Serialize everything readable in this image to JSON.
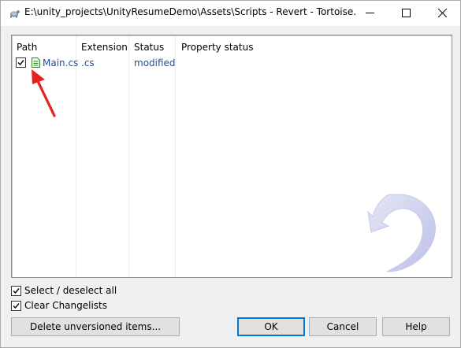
{
  "window": {
    "title": "E:\\unity_projects\\UnityResumeDemo\\Assets\\Scripts - Revert - Tortoise..."
  },
  "icons": {
    "app": "tortoisesvn-turtle-icon",
    "minimize": "minimize-icon",
    "maximize": "maximize-icon",
    "close": "close-icon",
    "file": "text-file-icon",
    "logo": "tortoisesvn-revert-logo",
    "annotation": "red-arrow-annotation"
  },
  "list": {
    "columns": [
      "Path",
      "Extension",
      "Status",
      "Property status"
    ],
    "rows": [
      {
        "checked": true,
        "path": "Main.cs",
        "extension": ".cs",
        "status": "modified",
        "property_status": ""
      }
    ]
  },
  "options": {
    "select_all_label": "Select / deselect all",
    "clear_changelists_label": "Clear Changelists"
  },
  "buttons": {
    "delete_unversioned": "Delete unversioned items...",
    "ok": "OK",
    "cancel": "Cancel",
    "help": "Help"
  },
  "colors": {
    "modified_text": "#1f4d9c",
    "annotation_arrow": "#e8201e",
    "default_button_border": "#0078d7"
  }
}
